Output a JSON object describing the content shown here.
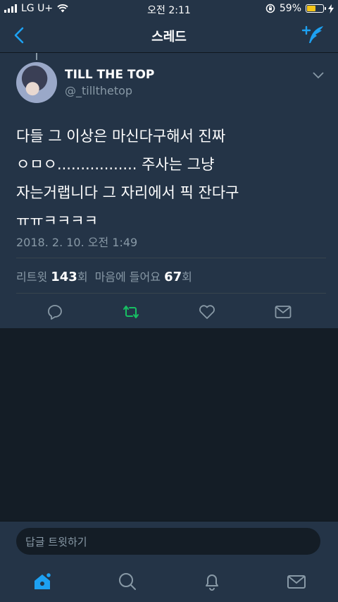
{
  "status": {
    "carrier": "LG U+",
    "time": "오전 2:11",
    "battery": "59%",
    "battery_fraction": 0.59
  },
  "nav": {
    "title": "스레드",
    "icons": [
      "back-chevron-icon",
      "compose-tweet-icon"
    ]
  },
  "tweet": {
    "name": "TILL THE TOP",
    "handle": "@_tillthetop",
    "lines": [
      "다들 그 이상은 마신다구해서 진짜",
      "ㅇㅁㅇ................. 주사는 그냥",
      "자는거랩니다 그 자리에서 픽 잔다구",
      "ㅠㅠㅋㅋㅋㅋ"
    ],
    "timestamp": "2018. 2. 10. 오전 1:49",
    "stats": {
      "retweet_label": "리트윗 ",
      "retweet_count": "143",
      "retweet_unit": "회",
      "like_label": "마음에 들어요 ",
      "like_count": "67",
      "like_unit": "회"
    },
    "action_icons": [
      "reply-icon",
      "retweet-icon",
      "like-icon",
      "dm-icon"
    ],
    "retweet_active_color": "#17bf63"
  },
  "reply": {
    "placeholder": "답글 트윗하기"
  },
  "tabbar": {
    "icons": [
      "home-icon",
      "search-icon",
      "notifications-icon",
      "messages-icon"
    ],
    "active_color": "#1da1f2"
  }
}
